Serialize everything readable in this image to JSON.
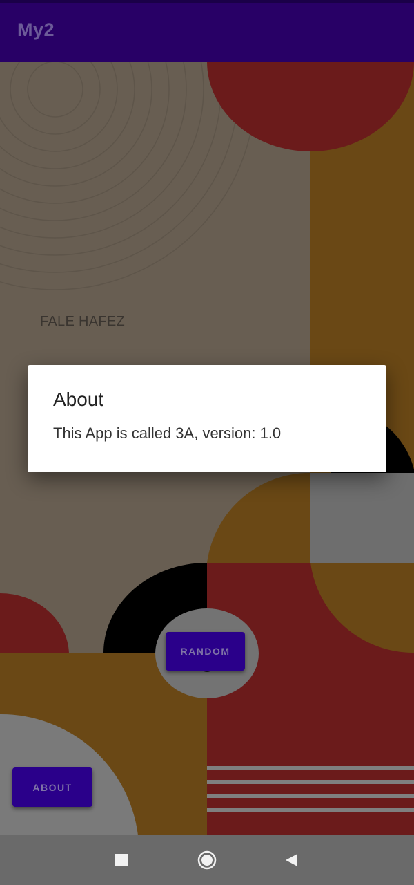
{
  "app": {
    "title": "My2"
  },
  "content": {
    "heading": "FALE HAFEZ",
    "random_button": "RANDOM",
    "about_button": "ABOUT"
  },
  "dialog": {
    "title": "About",
    "message": "This App is called 3A, version: 1.0"
  },
  "navbar": {
    "recents_icon": "square-icon",
    "home_icon": "circle-home-icon",
    "back_icon": "triangle-back-icon"
  },
  "colors": {
    "appbar": "#280066",
    "button": "#2a008a",
    "background_dim": "#685e52",
    "brown": "#6a4815",
    "red": "#6b1b1b"
  }
}
